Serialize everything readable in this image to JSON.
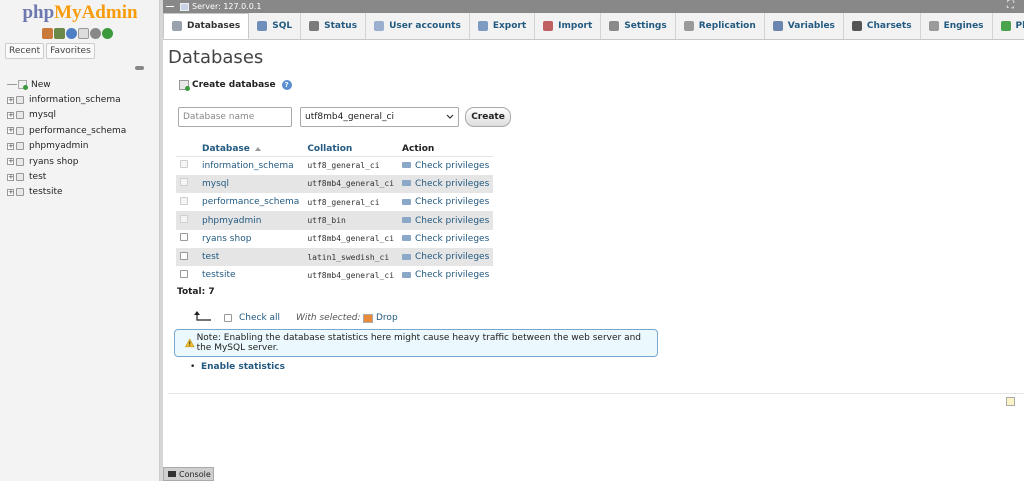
{
  "app": {
    "logo_part1": "php",
    "logo_part2": "MyAdmin"
  },
  "nav": {
    "tabs": [
      "Recent",
      "Favorites"
    ],
    "new_label": "New",
    "databases": [
      "information_schema",
      "mysql",
      "performance_schema",
      "phpmyadmin",
      "ryans shop",
      "test",
      "testsite"
    ]
  },
  "serverbar": {
    "title": "Server: 127.0.0.1",
    "close": "⛶"
  },
  "menu": {
    "tabs": [
      {
        "label": "Databases",
        "icon": "database-icon",
        "color": "#9aa3ad"
      },
      {
        "label": "SQL",
        "icon": "sql-icon",
        "color": "#6f8fba"
      },
      {
        "label": "Status",
        "icon": "status-icon",
        "color": "#7b7b7b"
      },
      {
        "label": "User accounts",
        "icon": "users-icon",
        "color": "#9aaed0"
      },
      {
        "label": "Export",
        "icon": "export-icon",
        "color": "#7d9bc2"
      },
      {
        "label": "Import",
        "icon": "import-icon",
        "color": "#c06060"
      },
      {
        "label": "Settings",
        "icon": "wrench-icon",
        "color": "#8a8a8a"
      },
      {
        "label": "Replication",
        "icon": "replication-icon",
        "color": "#9a9a9a"
      },
      {
        "label": "Variables",
        "icon": "variables-icon",
        "color": "#6b86b0"
      },
      {
        "label": "Charsets",
        "icon": "charsets-icon",
        "color": "#555"
      },
      {
        "label": "Engines",
        "icon": "engines-icon",
        "color": "#9a9a9a"
      },
      {
        "label": "Plugins",
        "icon": "plugins-icon",
        "color": "#4ba44b"
      }
    ]
  },
  "main": {
    "title": "Databases",
    "create_heading": "Create database",
    "help_glyph": "?",
    "db_name_placeholder": "Database name",
    "collation_value": "utf8mb4_general_ci",
    "create_button": "Create",
    "table": {
      "headers": {
        "database": "Database",
        "collation": "Collation",
        "action": "Action"
      },
      "rows": [
        {
          "name": "information_schema",
          "collation": "utf8_general_ci",
          "action": "Check privileges",
          "system": true
        },
        {
          "name": "mysql",
          "collation": "utf8mb4_general_ci",
          "action": "Check privileges",
          "system": true
        },
        {
          "name": "performance_schema",
          "collation": "utf8_general_ci",
          "action": "Check privileges",
          "system": true
        },
        {
          "name": "phpmyadmin",
          "collation": "utf8_bin",
          "action": "Check privileges",
          "system": true
        },
        {
          "name": "ryans shop",
          "collation": "utf8mb4_general_ci",
          "action": "Check privileges",
          "system": false
        },
        {
          "name": "test",
          "collation": "latin1_swedish_ci",
          "action": "Check privileges",
          "system": false
        },
        {
          "name": "testsite",
          "collation": "utf8mb4_general_ci",
          "action": "Check privileges",
          "system": false
        }
      ],
      "total": "Total: 7"
    },
    "check_all": "Check all",
    "with_selected": "With selected:",
    "drop": "Drop",
    "notice": "Note: Enabling the database statistics here might cause heavy traffic between the web server and the MySQL server.",
    "bullet": "•",
    "enable_statistics": "Enable statistics"
  },
  "console": {
    "label": "Console"
  }
}
